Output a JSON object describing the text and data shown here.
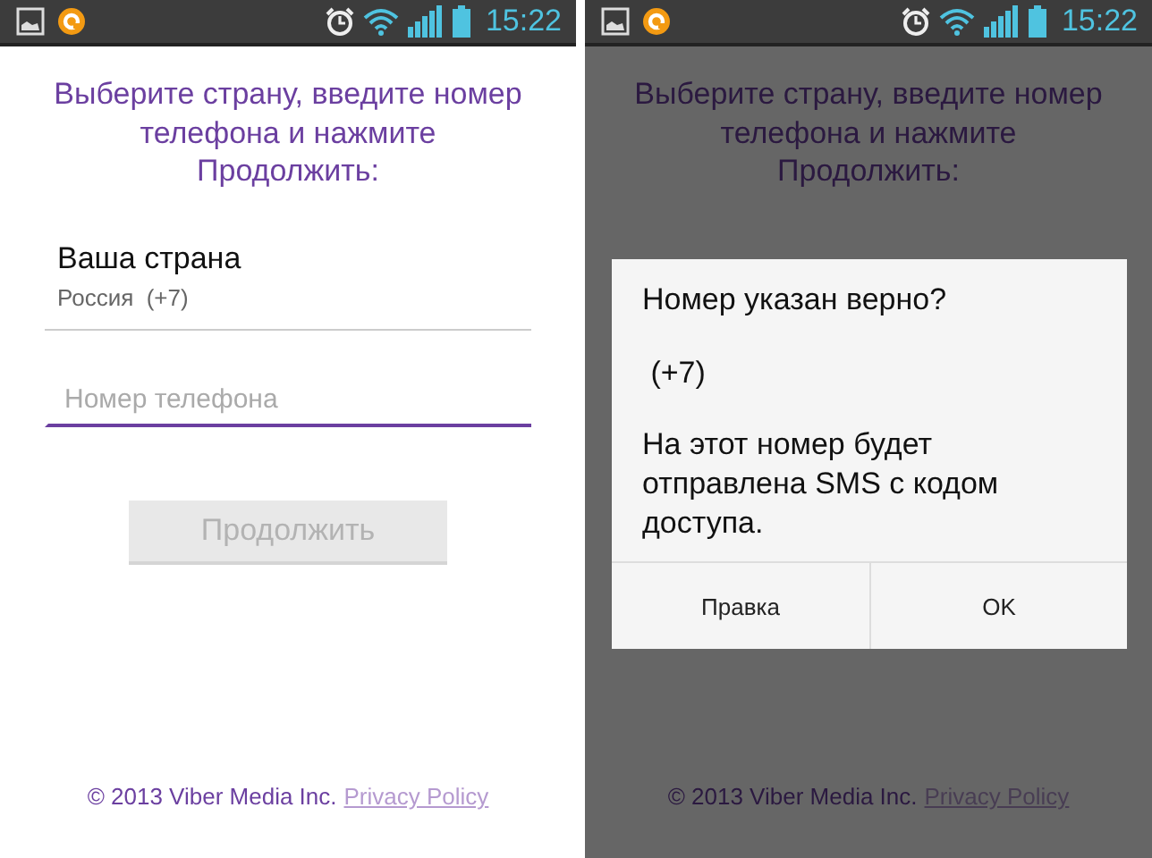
{
  "screens": [
    {
      "status_bar": {
        "time": "15:22"
      },
      "dimmed": false,
      "title": "Выберите страну, введите номер телефона и нажмите Продолжить:",
      "country": {
        "label": "Ваша страна",
        "value": "Россия  (+7)"
      },
      "phone_field": {
        "placeholder": "Номер телефона"
      },
      "continue_button": {
        "label": "Продолжить",
        "disabled": true
      },
      "footer": {
        "copyright": "© 2013 Viber Media Inc.",
        "link": "Privacy Policy"
      }
    },
    {
      "status_bar": {
        "time": "15:22"
      },
      "dimmed": true,
      "title": "Выберите страну, введите номер телефона и нажмите Продолжить:",
      "footer": {
        "copyright": "© 2013 Viber Media Inc.",
        "link": "Privacy Policy"
      },
      "dialog": {
        "title": "Номер указан верно?",
        "number": " (+7)",
        "message": "На этот номер будет отправлена SMS с кодом доступа.",
        "buttons": [
          "Правка",
          "OK"
        ]
      }
    }
  ]
}
